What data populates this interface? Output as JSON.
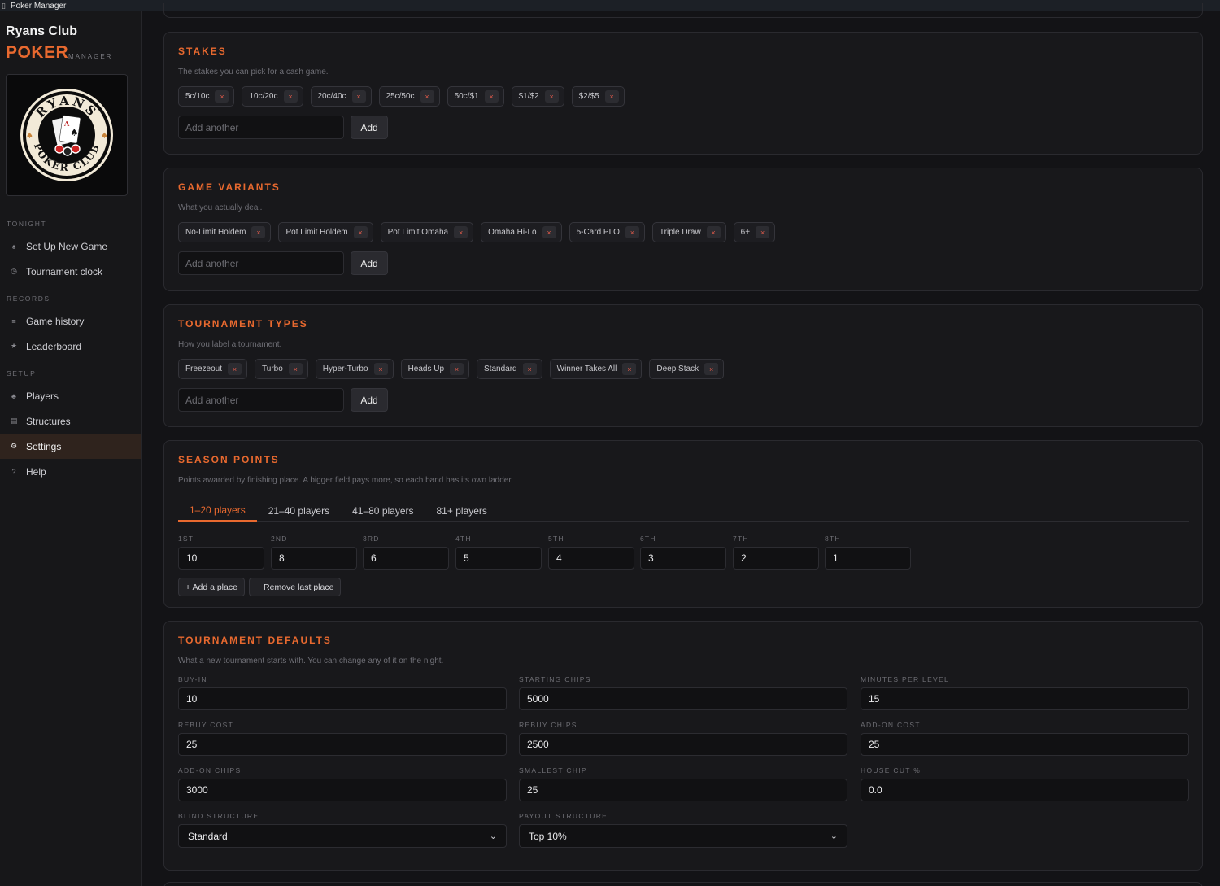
{
  "window": {
    "title": "Poker Manager"
  },
  "brand": {
    "club": "Ryans Club",
    "poker": "POKER",
    "manager": "MANAGER",
    "logo_text_top": "RYANS",
    "logo_text_bottom": "POKER CLUB"
  },
  "nav": {
    "sections": [
      {
        "title": "TONIGHT",
        "items": [
          {
            "label": "Set Up New Game",
            "icon": "spade-icon"
          },
          {
            "label": "Tournament clock",
            "icon": "clock-icon"
          }
        ]
      },
      {
        "title": "RECORDS",
        "items": [
          {
            "label": "Game history",
            "icon": "list-icon"
          },
          {
            "label": "Leaderboard",
            "icon": "star-icon"
          }
        ]
      },
      {
        "title": "SETUP",
        "items": [
          {
            "label": "Players",
            "icon": "club-icon"
          },
          {
            "label": "Structures",
            "icon": "structure-icon"
          },
          {
            "label": "Settings",
            "icon": "gear-icon",
            "active": true
          },
          {
            "label": "Help",
            "icon": "help-icon"
          }
        ]
      }
    ]
  },
  "stakes": {
    "title": "STAKES",
    "desc": "The stakes you can pick for a cash game.",
    "chips": [
      "5c/10c",
      "10c/20c",
      "20c/40c",
      "25c/50c",
      "50c/$1",
      "$1/$2",
      "$2/$5"
    ],
    "placeholder": "Add another",
    "add_label": "Add"
  },
  "variants": {
    "title": "GAME VARIANTS",
    "desc": "What you actually deal.",
    "chips": [
      "No-Limit Holdem",
      "Pot Limit Holdem",
      "Pot Limit Omaha",
      "Omaha Hi-Lo",
      "5-Card PLO",
      "Triple Draw",
      "6+"
    ],
    "placeholder": "Add another",
    "add_label": "Add"
  },
  "tournament_types": {
    "title": "TOURNAMENT TYPES",
    "desc": "How you label a tournament.",
    "chips": [
      "Freezeout",
      "Turbo",
      "Hyper-Turbo",
      "Heads Up",
      "Standard",
      "Winner Takes All",
      "Deep Stack"
    ],
    "placeholder": "Add another",
    "add_label": "Add"
  },
  "season_points": {
    "title": "SEASON POINTS",
    "desc": "Points awarded by finishing place. A bigger field pays more, so each band has its own ladder.",
    "tabs": [
      "1–20 players",
      "21–40 players",
      "41–80 players",
      "81+ players"
    ],
    "active_tab": 0,
    "places": [
      {
        "label": "1ST",
        "value": "10"
      },
      {
        "label": "2ND",
        "value": "8"
      },
      {
        "label": "3RD",
        "value": "6"
      },
      {
        "label": "4TH",
        "value": "5"
      },
      {
        "label": "5TH",
        "value": "4"
      },
      {
        "label": "6TH",
        "value": "3"
      },
      {
        "label": "7TH",
        "value": "2"
      },
      {
        "label": "8TH",
        "value": "1"
      }
    ],
    "add_place": "+ Add a place",
    "remove_place": "− Remove last place"
  },
  "defaults": {
    "title": "TOURNAMENT DEFAULTS",
    "desc": "What a new tournament starts with. You can change any of it on the night.",
    "fields": [
      {
        "label": "BUY-IN",
        "value": "10"
      },
      {
        "label": "STARTING CHIPS",
        "value": "5000"
      },
      {
        "label": "MINUTES PER LEVEL",
        "value": "15"
      },
      {
        "label": "REBUY COST",
        "value": "25"
      },
      {
        "label": "REBUY CHIPS",
        "value": "2500"
      },
      {
        "label": "ADD-ON COST",
        "value": "25"
      },
      {
        "label": "ADD-ON CHIPS",
        "value": "3000"
      },
      {
        "label": "SMALLEST CHIP",
        "value": "25"
      },
      {
        "label": "HOUSE CUT %",
        "value": "0.0"
      }
    ],
    "selects": [
      {
        "label": "BLIND STRUCTURE",
        "value": "Standard"
      },
      {
        "label": "PAYOUT STRUCTURE",
        "value": "Top 10%"
      }
    ]
  },
  "colors": {
    "accent": "#e8692f",
    "background": "#131316",
    "card": "#18181b",
    "active_nav": "#2f231d"
  }
}
